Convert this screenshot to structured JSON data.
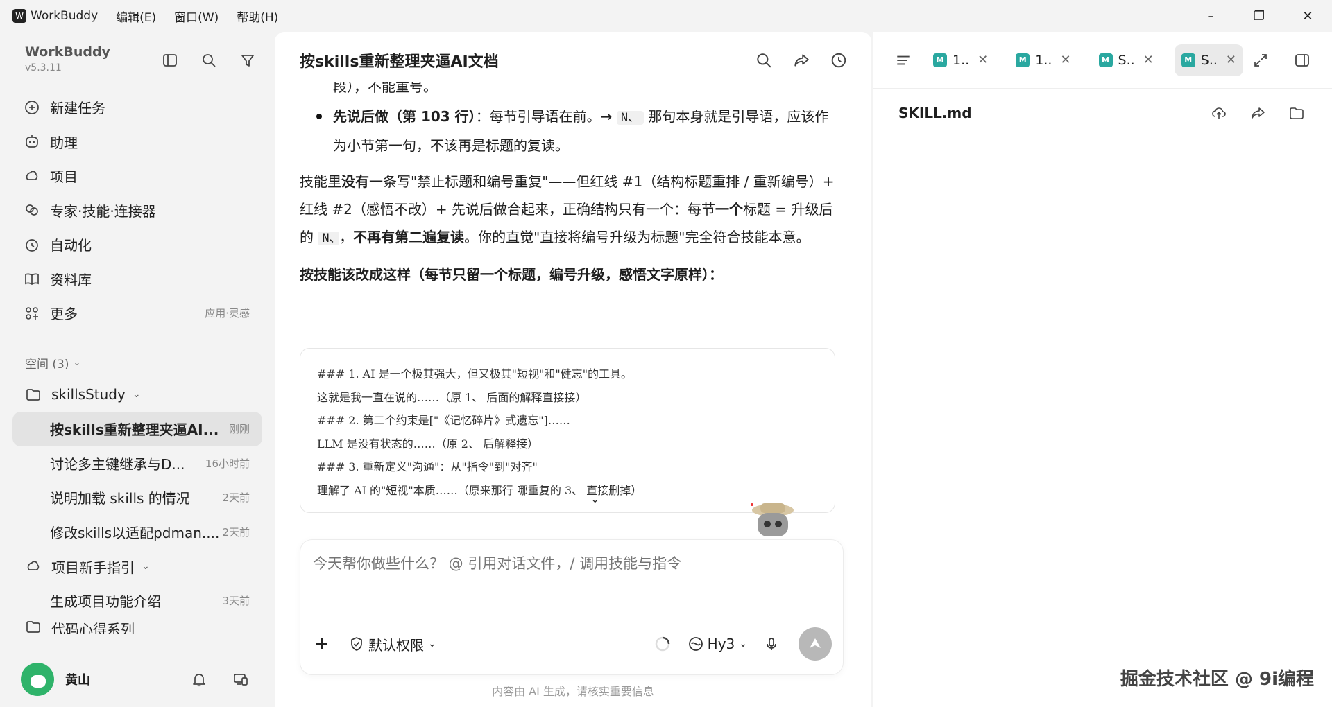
{
  "titlebar": {
    "app_name": "WorkBuddy",
    "menus": [
      "编辑(E)",
      "窗口(W)",
      "帮助(H)"
    ],
    "min": "–",
    "max": "❐",
    "close": "✕"
  },
  "sidebar": {
    "brand": "WorkBuddy",
    "version": "v5.3.11",
    "nav": [
      {
        "label": "新建任务",
        "icon": "plus-circle-icon"
      },
      {
        "label": "助理",
        "icon": "robot-icon"
      },
      {
        "label": "项目",
        "icon": "project-icon"
      },
      {
        "label": "专家·技能·连接器",
        "icon": "expert-icon"
      },
      {
        "label": "自动化",
        "icon": "clock-icon"
      },
      {
        "label": "资料库",
        "icon": "book-icon"
      },
      {
        "label": "更多",
        "icon": "grid-icon",
        "hint": "应用·灵感"
      }
    ],
    "space_label": "空间 (3)",
    "tree": [
      {
        "type": "folder",
        "label": "skillsStudy"
      },
      {
        "type": "task",
        "label": "按skills重新整理夹逼AI...",
        "time": "刚刚",
        "active": true
      },
      {
        "type": "task",
        "label": "讨论多主键继承与D...",
        "time": "16小时前"
      },
      {
        "type": "task",
        "label": "说明加载 skills 的情况",
        "time": "2天前"
      },
      {
        "type": "task",
        "label": "修改skills以适配pdman....",
        "time": "2天前"
      },
      {
        "type": "folder",
        "label": "项目新手指引"
      },
      {
        "type": "task",
        "label": "生成项目功能介绍",
        "time": "3天前"
      },
      {
        "type": "folder",
        "label": "代码心得系列"
      }
    ],
    "user": "黄山"
  },
  "main": {
    "title": "按skills重新整理夹逼AI文档",
    "partial_top": "段），不能重号。",
    "bullet_bold": "先说后做（第 103 行）",
    "bullet_rest1": "：每节引导语在前。→",
    "bullet_code": "N、",
    "bullet_rest2": "那句本身就是引导语，应该作为小节第一句，不该再是标题的复读。",
    "para1_a": "技能里",
    "para1_b": "没有",
    "para1_c": "一条写\"禁止标题和编号重复\"——但红线 #1（结构标题重排 / 重新编号）+ 红线 #2（感悟不改）+ 先说后做合起来，正确结构只有一个：每节",
    "para1_d": "一个",
    "para1_e": "标题 = 升级后的",
    "para1_code": "N、",
    "para1_f": "，",
    "para1_g": "不再有第二遍复读",
    "para1_h": "。你的直觉\"直接将编号升级为标题\"完全符合技能本意。",
    "heading2": "按技能该改成这样（每节只留一个标题，编号升级，感悟文字原样）：",
    "code_lines": [
      "### 1. AI 是一个极其强大，但又极其\"短视\"和\"健忘\"的工具。",
      "这就是我一直在说的……（原 1、 后面的解释直接接）",
      "### 2. 第二个约束是[\"《记忆碎片》式遗忘\"]……",
      "LLM 是没有状态的……（原 2、 后解释接）",
      "### 3. 重新定义\"沟通\"：从\"指令\"到\"对齐\"",
      "理解了 AI 的\"短视\"本质……（原来那行   哪重复的 3、 直接删掉）"
    ],
    "input_placeholder": "今天帮你做些什么？ @ 引用对话文件，/ 调用技能与指令",
    "permission": "默认权限",
    "model": "Hy3",
    "disclaimer": "内容由 AI 生成，请核实重要信息"
  },
  "right": {
    "tabs": [
      {
        "label": "1..",
        "active": false
      },
      {
        "label": "1..",
        "active": false
      },
      {
        "label": "S..",
        "active": false
      },
      {
        "label": "S..",
        "active": true
      }
    ],
    "md_badge": "M",
    "file_name": "SKILL.md",
    "watermark": "掘金技术社区 @ 9i编程"
  }
}
